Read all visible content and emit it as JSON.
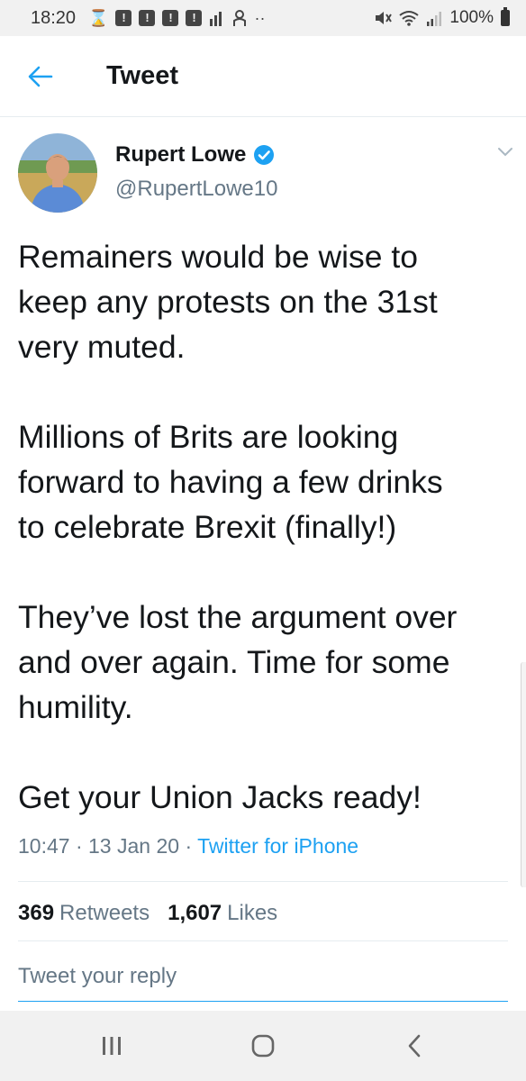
{
  "status_bar": {
    "time": "18:20",
    "battery": "100%",
    "icons": [
      "hourglass-icon",
      "notification-icon",
      "notification-icon",
      "notification-icon",
      "notification-icon",
      "signal-bars-icon",
      "person-icon",
      "more-dots-icon",
      "mute-icon",
      "wifi-icon",
      "cell-signal-icon",
      "battery-icon"
    ]
  },
  "header": {
    "title": "Tweet"
  },
  "tweet": {
    "author_name": "Rupert Lowe",
    "author_handle": "@RupertLowe10",
    "verified": true,
    "text": "Remainers would be wise to\nkeep any protests on the 31st\nvery muted.\n\nMillions of Brits are looking\nforward to having a few drinks\nto celebrate Brexit (finally!)\n\nThey’ve lost the argument over\nand over again. Time for some\nhumility.\n\nGet your Union Jacks ready!",
    "time": "10:47",
    "date": "13 Jan 20",
    "source": "Twitter for iPhone",
    "separator": "·",
    "retweets_count": "369",
    "retweets_label": "Retweets",
    "likes_count": "1,607",
    "likes_label": "Likes"
  },
  "reply": {
    "placeholder": "Tweet your reply"
  },
  "colors": {
    "accent": "#1da1f2",
    "text": "#14171a",
    "muted": "#657786"
  }
}
